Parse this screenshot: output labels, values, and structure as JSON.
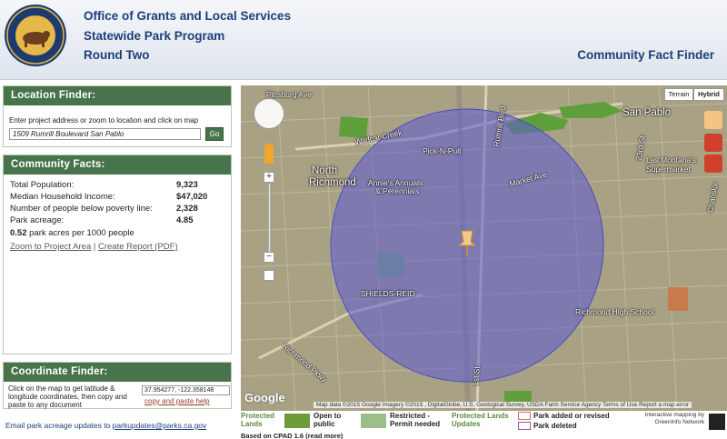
{
  "header": {
    "logo_top_text": "CALIFORNIA",
    "logo_bottom_text": "STATE PARKS",
    "logo_since": "Since 1864",
    "line1": "Office of Grants and Local Services",
    "line2": "Statewide Park Program",
    "line3": "Round Two",
    "right_title": "Community Fact Finder"
  },
  "location_finder": {
    "heading": "Location Finder:",
    "instructions": "Enter project address or zoom to location and click on map",
    "address_value": "1509 Rumrill Boulevard San Pablo",
    "go_label": "Go"
  },
  "community_facts": {
    "heading": "Community Facts:",
    "rows": [
      {
        "label": "Total Population:",
        "value": "9,323"
      },
      {
        "label": "Median Household Income:",
        "value": "$47,020"
      },
      {
        "label": "Number of people below poverty line:",
        "value": "2,328"
      },
      {
        "label": "Park acreage:",
        "value": "4.85"
      }
    ],
    "per_capita_value": "0.52",
    "per_capita_label": "park acres per 1000 people",
    "zoom_link": "Zoom to Project Area",
    "separator": "|",
    "report_link": "Create Report (PDF)"
  },
  "coordinate_finder": {
    "heading": "Coordinate Finder:",
    "instructions": "Click on the map to get latitude & longitude coordinates, then copy and paste to any document",
    "coords_value": "37.954277, -122.358148",
    "copy_link": "copy and paste help"
  },
  "footer": {
    "email_text": "Email park acreage updates to",
    "email_link": "parkupdates@parks.ca.gov"
  },
  "map": {
    "type_terrain": "Terrain",
    "type_hybrid": "Hybrid",
    "labels": {
      "pittsburg": "Pittsburg Ave",
      "san_pablo": "San Pablo",
      "wildcat": "Wildcat Creek",
      "pick_n_pull": "Pick-N-Pull",
      "rumrill": "Rumrill Blvd",
      "north_richmond_1": "North",
      "north_richmond_2": "Richmond",
      "annies_1": "Annie's Annuals",
      "annies_2": "& Perennials",
      "market": "Market Ave",
      "las_montanas_1": "Las Montana's",
      "las_montanas_2": "Supermarket",
      "st23": "23rd St",
      "shields": "SHIELDS-REID",
      "richmond_high": "Richmond High School",
      "richmond_pkwy": "Richmond Pkwy",
      "st1": "1st St",
      "chanslor": "Chanslor"
    },
    "google": "Google",
    "attribution": "Map data ©2015 Google Imagery ©2015 , DigitalGlobe, U.S. Geological Survey, USDA Farm Service Agency   Terms of Use   Report a map error"
  },
  "legend": {
    "protected_lands_title": "Protected Lands",
    "open_public": "Open to public",
    "restricted": "Restricted - Permit needed",
    "updates_title": "Protected Lands Updates",
    "added_revised": "Park added or revised",
    "deleted": "Park deleted",
    "credit": "Interactive mapping by GreenInfo Network",
    "cpad": "Based on CPAD 1.6 (read more)",
    "colors": {
      "open": "#6f9b3a",
      "restricted": "#9bbf86",
      "added": "#d96a6a",
      "deleted": "#8d5fa8",
      "circle": "#5b5bd6"
    }
  }
}
